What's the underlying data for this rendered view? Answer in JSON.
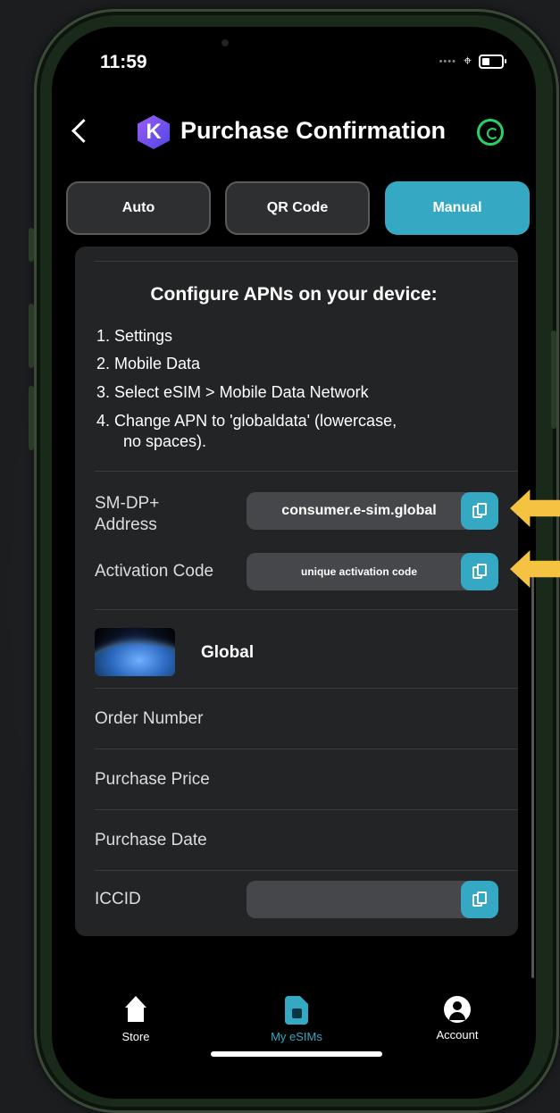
{
  "status": {
    "time": "11:59"
  },
  "header": {
    "title": "Purchase Confirmation",
    "logo_letter": "K"
  },
  "tabs": [
    {
      "label": "Auto",
      "selected": false
    },
    {
      "label": "QR Code",
      "selected": false
    },
    {
      "label": "Manual",
      "selected": true
    }
  ],
  "config": {
    "title": "Configure APNs on your device:",
    "steps": [
      "1. Settings",
      "2. Mobile Data",
      "3. Select eSIM > Mobile Data Network",
      "4. Change APN to 'globaldata' (lowercase,",
      "no spaces)."
    ]
  },
  "fields": {
    "smdp_label_1": "SM-DP+",
    "smdp_label_2": "Address",
    "smdp_value": "consumer.e-sim.global",
    "activation_label": "Activation Code",
    "activation_value": "unique activation code",
    "iccid_label": "ICCID",
    "iccid_value": ""
  },
  "plan": {
    "name": "Global"
  },
  "details": {
    "order_number": "Order Number",
    "purchase_price": "Purchase Price",
    "purchase_date": "Purchase Date"
  },
  "nav": [
    {
      "label": "Store",
      "active": false
    },
    {
      "label": "My eSIMs",
      "active": true
    },
    {
      "label": "Account",
      "active": false
    }
  ],
  "colors": {
    "accent": "#35a9c4",
    "arrow": "#f5c242",
    "whatsapp": "#25d366"
  },
  "icons": [
    "back-chevron-icon",
    "whatsapp-icon",
    "copy-icon",
    "home-icon",
    "sim-card-icon",
    "account-icon"
  ]
}
